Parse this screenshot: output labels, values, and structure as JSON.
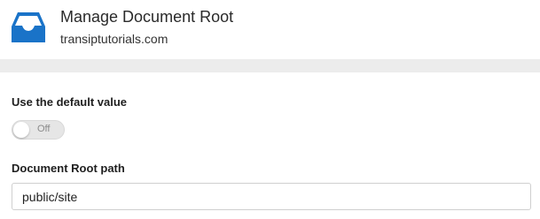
{
  "header": {
    "title": "Manage Document Root",
    "subtitle": "transiptutorials.com",
    "icon": "inbox-tray-icon",
    "icon_color": "#1a73c8"
  },
  "default_value": {
    "label": "Use the default value",
    "toggle_state": "Off"
  },
  "document_root": {
    "label": "Document Root path",
    "value": "public/site"
  }
}
